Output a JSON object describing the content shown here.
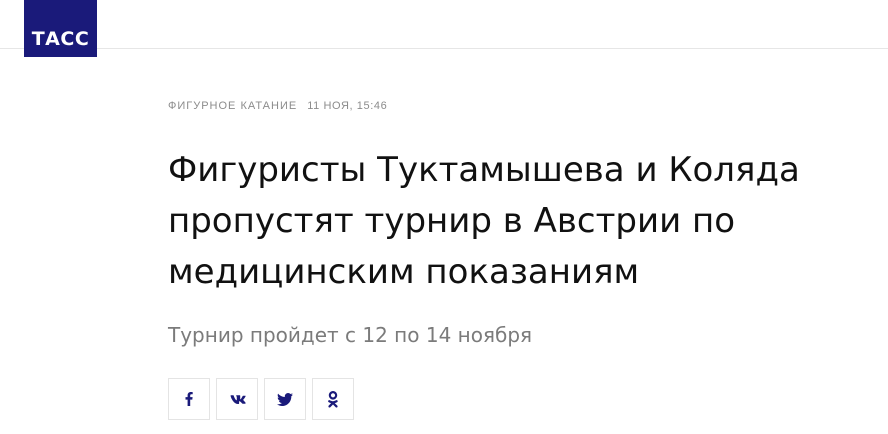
{
  "header": {
    "logo_text": "ТАСС"
  },
  "article": {
    "rubric": "ФИГУРНОЕ КАТАНИЕ",
    "date": "11 НОЯ, 15:46",
    "title": "Фигуристы Туктамышева и Коляда пропустят турнир в Австрии по медицинским показаниям",
    "lead": "Турнир пройдет с 12 по 14 ноября"
  },
  "share": {
    "buttons": [
      {
        "icon": "facebook-icon"
      },
      {
        "icon": "vk-icon"
      },
      {
        "icon": "twitter-icon"
      },
      {
        "icon": "odnoklassniki-icon"
      }
    ]
  },
  "colors": {
    "brand": "#1a1a7a",
    "social_icon": "#1a1a7a",
    "meta_text": "#8c8c8c",
    "lead_text": "#7b7b7b"
  }
}
